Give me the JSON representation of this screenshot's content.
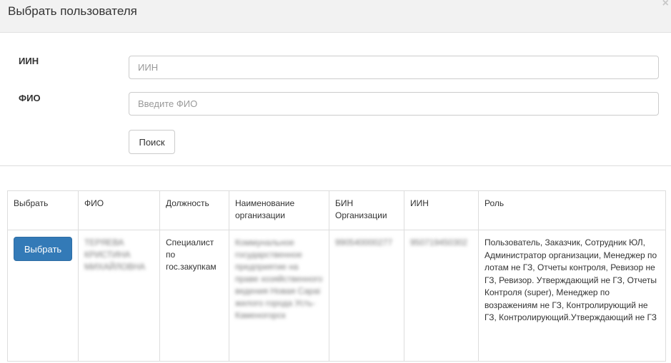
{
  "modal": {
    "title": "Выбрать пользователя",
    "close_label": "×"
  },
  "form": {
    "iin_label": "ИИН",
    "iin_placeholder": "ИИН",
    "iin_value": "",
    "fio_label": "ФИО",
    "fio_placeholder": "Введите ФИО",
    "fio_value": "",
    "search_label": "Поиск"
  },
  "table": {
    "headers": [
      "Выбрать",
      "ФИО",
      "Должность",
      "Наименование организации",
      "БИН Организации",
      "ИИН",
      "Роль"
    ],
    "rows": [
      {
        "select_label": "Выбрать",
        "fio": "ТЕРЯЕВА КРИСТИНА МИХАЙЛОВНА",
        "position": "Специалист по гос.закупкам",
        "org_name": "Коммунальное государственное предприятие на праве хозяйственного ведения Новая Сараі жилого города Усть-Каменогорск",
        "bin": "990540000277",
        "iin": "950719450302",
        "role": "Пользователь, Заказчик, Сотрудник ЮЛ, Администратор организации, Менеджер по лотам не ГЗ, Отчеты контроля, Ревизор не ГЗ, Ревизор. Утверждающий не ГЗ, Отчеты Контроля (super), Менеджер по возражениям не ГЗ, Контролирующий не ГЗ, Контролирующий.Утверждающий не ГЗ"
      }
    ]
  },
  "colors": {
    "primary": "#337ab7",
    "header_bg": "#f2f2f2",
    "border": "#dddddd"
  }
}
